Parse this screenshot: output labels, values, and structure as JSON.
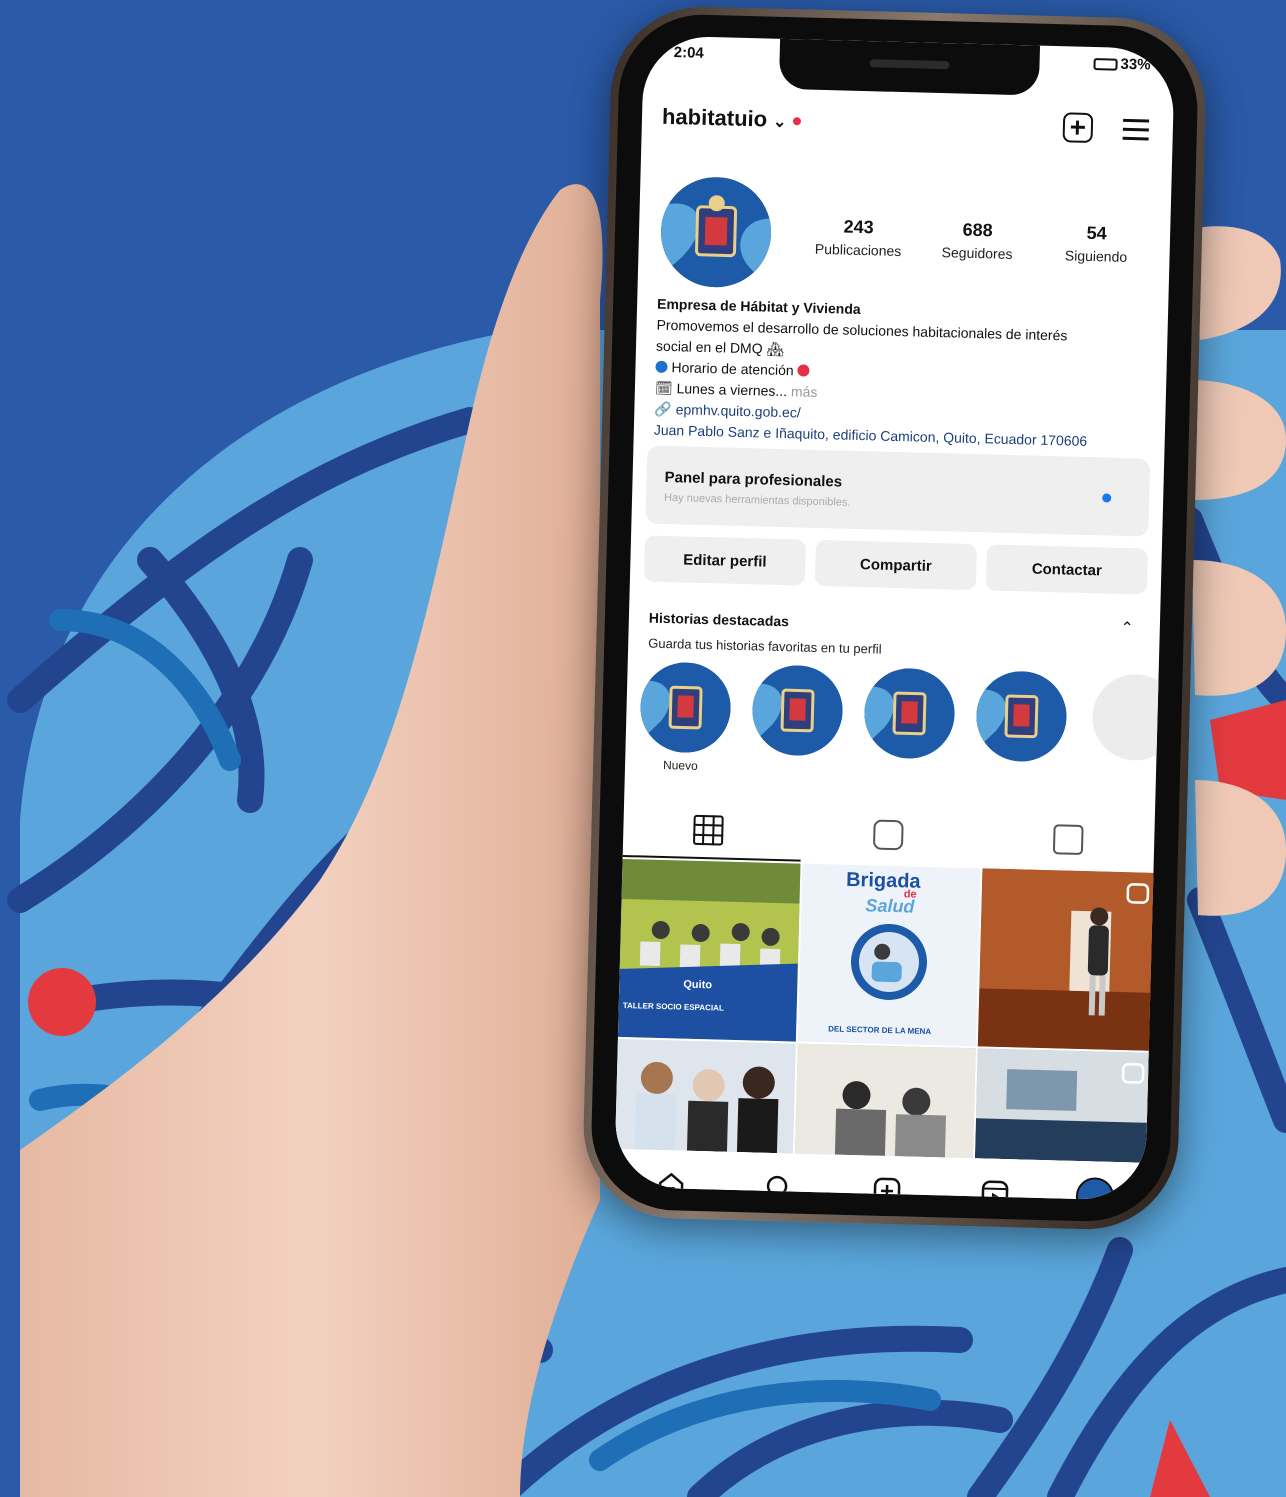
{
  "status_bar": {
    "time": "2:04",
    "battery": "33%"
  },
  "header": {
    "username": "habitatuio",
    "chevron": "⌄"
  },
  "profile": {
    "stats": [
      {
        "value": "243",
        "label": "Publicaciones"
      },
      {
        "value": "688",
        "label": "Seguidores"
      },
      {
        "value": "54",
        "label": "Siguiendo"
      }
    ],
    "bio": {
      "name": "Empresa de Hábitat y Vivienda",
      "line1": "Promovemos el desarrollo de soluciones habitacionales de interés",
      "line2": "social en el DMQ",
      "line3": "Horario de atención",
      "line4": "Lunes a viernes...",
      "more": "más",
      "website": "epmhv.quito.gob.ec/",
      "address": "Juan Pablo Sanz e Iñaquito, edificio Camicon, Quito, Ecuador 170606"
    }
  },
  "professional_panel": {
    "title": "Panel para profesionales",
    "subtitle": "Hay nuevas herramientas disponibles."
  },
  "buttons": {
    "edit": "Editar perfil",
    "share": "Compartir",
    "contact": "Contactar"
  },
  "highlights": {
    "title": "Historias destacadas",
    "subtitle": "Guarda tus historias favoritas en tu perfil",
    "new_label": "Nuevo"
  },
  "posts": {
    "p1_line1": "Quito",
    "p1_line2": "TALLER SOCIO ESPACIAL",
    "p2_line1": "Brigada",
    "p2_line2": "de",
    "p2_line3": "Salud",
    "p2_footer": "DEL SECTOR DE LA MENA"
  },
  "colors": {
    "background": "#2a5aa8",
    "accent_blue": "#1877f2",
    "notification_red": "#e53148"
  },
  "icons": [
    "new-post-icon",
    "menu-icon",
    "grid-icon",
    "reels-icon",
    "tagged-icon",
    "home-icon",
    "search-icon",
    "create-icon",
    "reels-nav-icon",
    "profile-avatar-icon"
  ]
}
